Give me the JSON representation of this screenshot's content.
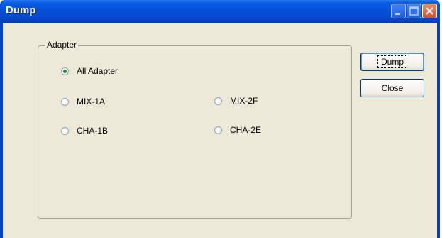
{
  "window": {
    "title": "Dump"
  },
  "group": {
    "label": "Adapter"
  },
  "radios": [
    {
      "label": "All Adapter",
      "checked": true
    },
    {
      "label": "MIX-1A",
      "checked": false
    },
    {
      "label": "MIX-2F",
      "checked": false
    },
    {
      "label": "CHA-1B",
      "checked": false
    },
    {
      "label": "CHA-2E",
      "checked": false
    }
  ],
  "buttons": {
    "dump": "Dump",
    "close": "Close"
  }
}
